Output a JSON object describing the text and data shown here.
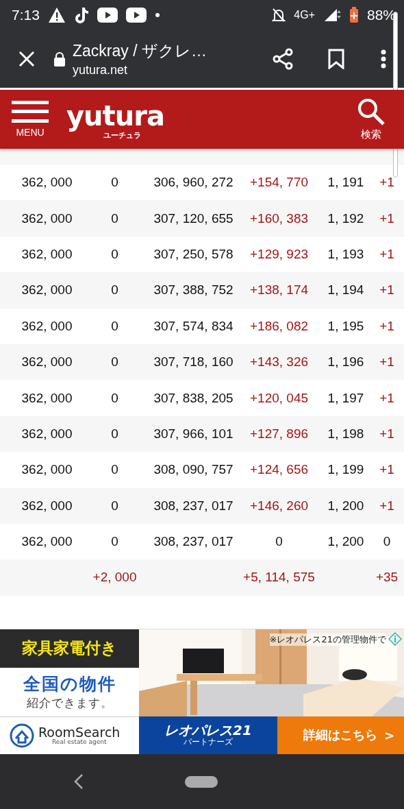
{
  "status_bar": {
    "time": "7:13",
    "network": "4G+",
    "battery": "88%"
  },
  "browser": {
    "title": "Zackray / ザクレ…",
    "url": "yutura.net"
  },
  "header": {
    "menu_label": "MENU",
    "logo": "yutura",
    "logo_sub": "ユーチュラ",
    "search_label": "検索"
  },
  "table": {
    "rows": [
      {
        "cells": [
          {
            "text": "362, 000"
          },
          {
            "text": "0",
            "up": false
          },
          {
            "text": "306, 960, 272"
          },
          {
            "text": "+154, 770",
            "up": true
          },
          {
            "text": "1, 191"
          },
          {
            "text": "+1",
            "up": true
          }
        ]
      },
      {
        "cells": [
          {
            "text": "362, 000"
          },
          {
            "text": "0",
            "up": false
          },
          {
            "text": "307, 120, 655"
          },
          {
            "text": "+160, 383",
            "up": true
          },
          {
            "text": "1, 192"
          },
          {
            "text": "+1",
            "up": true
          }
        ]
      },
      {
        "cells": [
          {
            "text": "362, 000"
          },
          {
            "text": "0",
            "up": false
          },
          {
            "text": "307, 250, 578"
          },
          {
            "text": "+129, 923",
            "up": true
          },
          {
            "text": "1, 193"
          },
          {
            "text": "+1",
            "up": true
          }
        ]
      },
      {
        "cells": [
          {
            "text": "362, 000"
          },
          {
            "text": "0",
            "up": false
          },
          {
            "text": "307, 388, 752"
          },
          {
            "text": "+138, 174",
            "up": true
          },
          {
            "text": "1, 194"
          },
          {
            "text": "+1",
            "up": true
          }
        ]
      },
      {
        "cells": [
          {
            "text": "362, 000"
          },
          {
            "text": "0",
            "up": false
          },
          {
            "text": "307, 574, 834"
          },
          {
            "text": "+186, 082",
            "up": true
          },
          {
            "text": "1, 195"
          },
          {
            "text": "+1",
            "up": true
          }
        ]
      },
      {
        "cells": [
          {
            "text": "362, 000"
          },
          {
            "text": "0",
            "up": false
          },
          {
            "text": "307, 718, 160"
          },
          {
            "text": "+143, 326",
            "up": true
          },
          {
            "text": "1, 196"
          },
          {
            "text": "+1",
            "up": true
          }
        ]
      },
      {
        "cells": [
          {
            "text": "362, 000"
          },
          {
            "text": "0",
            "up": false
          },
          {
            "text": "307, 838, 205"
          },
          {
            "text": "+120, 045",
            "up": true
          },
          {
            "text": "1, 197"
          },
          {
            "text": "+1",
            "up": true
          }
        ]
      },
      {
        "cells": [
          {
            "text": "362, 000"
          },
          {
            "text": "0",
            "up": false
          },
          {
            "text": "307, 966, 101"
          },
          {
            "text": "+127, 896",
            "up": true
          },
          {
            "text": "1, 198"
          },
          {
            "text": "+1",
            "up": true
          }
        ]
      },
      {
        "cells": [
          {
            "text": "362, 000"
          },
          {
            "text": "0",
            "up": false
          },
          {
            "text": "308, 090, 757"
          },
          {
            "text": "+124, 656",
            "up": true
          },
          {
            "text": "1, 199"
          },
          {
            "text": "+1",
            "up": true
          }
        ]
      },
      {
        "cells": [
          {
            "text": "362, 000"
          },
          {
            "text": "0",
            "up": false
          },
          {
            "text": "308, 237, 017"
          },
          {
            "text": "+146, 260",
            "up": true
          },
          {
            "text": "1, 200"
          },
          {
            "text": "+1",
            "up": true
          }
        ]
      },
      {
        "cells": [
          {
            "text": "362, 000"
          },
          {
            "text": "0",
            "up": false
          },
          {
            "text": "308, 237, 017"
          },
          {
            "text": "0",
            "up": false
          },
          {
            "text": "1, 200"
          },
          {
            "text": "0",
            "up": false
          }
        ]
      }
    ],
    "totals": {
      "subscribers_change": "+2, 000",
      "views_change": "+5, 114, 575",
      "videos_change": "+35"
    }
  },
  "ad": {
    "headline": "家具家電付き",
    "line_1": "全国の物件",
    "line_2": "紹介できます。",
    "brand": "RoomSearch",
    "brand_sub": "Real estate agent",
    "note": "※レオパレス21の管理物件で",
    "partner": "レオパレス21",
    "partner_sub": "パートナーズ",
    "cta": "詳細はこちら",
    "cta_arrow": ">"
  }
}
